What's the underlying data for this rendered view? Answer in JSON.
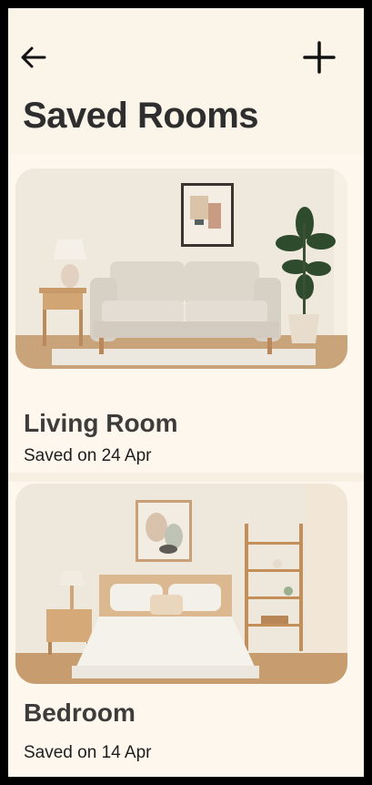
{
  "header": {
    "title": "Saved Rooms",
    "back_icon": "arrow-left-icon",
    "add_icon": "plus-icon"
  },
  "rooms": [
    {
      "name": "Living Room",
      "saved": "Saved on 24 Apr"
    },
    {
      "name": "Bedroom",
      "saved": "Saved on 14 Apr"
    }
  ],
  "colors": {
    "background": "#fdf7ee",
    "header": "#fbf4e8",
    "title": "#2e2e2e"
  }
}
